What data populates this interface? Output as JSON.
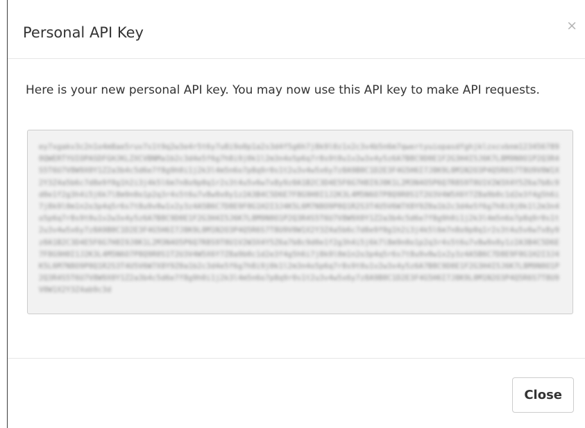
{
  "modal": {
    "title": "Personal API Key",
    "close_icon_glyph": "×",
    "message": "Here is your new personal API key. You may now use this API key to make API requests.",
    "api_key": "ey7xgakv3c2n1o4m8ae5ruv7s1t9q2w3e4r5t6y7u8i9o0p1a2s3d4f5g6h7j8k9l0z1x2c3v4b5n6m7qwertyuiopasdfghjklzxcvbnm1234567890QWERTYUIOPASDFGHJKLZXCVBNMa1b2c3d4e5f6g7h8i9j0k1l2m3n4o5p6q7r8s9t0u1v2w3x4y5z6A7B8C9D0E1F2G3H4I5J6K7L8M9N0O1P2Q3R4S5T6U7V8W9X0Y1Z2a3b4c5d6e7f8g9h0i1j2k3l4m5n6o7p8q9r0s1t2u3v4w5x6y7z8A9B0C1D2E3F4G5H6I7J8K9L0M1N2O3P4Q5R6S7T8U9V0W1X2Y3Z4a5b6c7d8e9f0g1h2i3j4k5l6m7n8o9p0q1r2s3t4u5v6w7x8y9z0A1B2C3D4E5F6G7H8I9J0K1L2M3N4O5P6Q7R8S9T0U1V2W3X4Y5Z6a7b8c9d0e1f2g3h4i5j6k7l8m9n0o1p2q3r4s5t6u7v8w9x0y1z2A3B4C5D6E7F8G9H0I1J2K3L4M5N6O7P8Q9R0S1T2U3V4W5X6Y7Z8a9b0c1d2e3f4g5h6i7j8k9l0m1n2o3p4q5r6s7t8u9v0w1x2y3z4A5B6C7D8E9F0G1H2I3J4K5L6M7N8O9P0Q1R2S3T4U5V6W7X8Y9Z0a1b2c3d4e5f6g7h8i9j0k1l2m3n4o5p6q7r8s9t0u1v2w3x4y5z6A7B8C9D0E1F2G3H4I5J6K7L8M9N0O1P2Q3R4S5T6U7V8W9X0Y1Z2a3b4c5d6e7f8g9h0i1j2k3l4m5n6o7p8q9r0s1t2u3v4w5x6y7z8A9B0C1D2E3F4G5H6I7J8K9L0M1N2O3P4Q5R6S7T8U9V0W1X2Y3Z4a5b6c7d8e9f0g1h2i3j4k5l6m7n8o9p0q1r2s3t4u5v6w7x8y9z0A1B2C3D4E5F6G7H8I9J0K1L2M3N4O5P6Q7R8S9T0U1V2W3X4Y5Z6a7b8c9d0e1f2g3h4i5j6k7l8m9n0o1p2q3r4s5t6u7v8w9x0y1z2A3B4C5D6E7F8G9H0I1J2K3L4M5N6O7P8Q9R0S1T2U3V4W5X6Y7Z8a9b0c1d2e3f4g5h6i7j8k9l0m1n2o3p4q5r6s7t8u9v0w1x2y3z4A5B6C7D8E9F0G1H2I3J4K5L6M7N8O9P0Q1R2S3T4U5V6W7X8Y9Z0a1b2c3d4e5f6g7h8i9j0k1l2m3n4o5p6q7r8s9t0u1v2w3x4y5z6A7B8C9D0E1F2G3H4I5J6K7L8M9N0O1P2Q3R4S5T6U7V8W9X0Y1Z2a3b4c5d6e7f8g9h0i1j2k3l4m5n6o7p8q9r0s1t2u3v4w5x6y7z8A9B0C1D2E3F4G5H6I7J8K9L0M1N2O3P4Q5R6S7T8U9V0W1X2Y3Z4ab9c3d"
  },
  "footer": {
    "close_label": "Close"
  }
}
